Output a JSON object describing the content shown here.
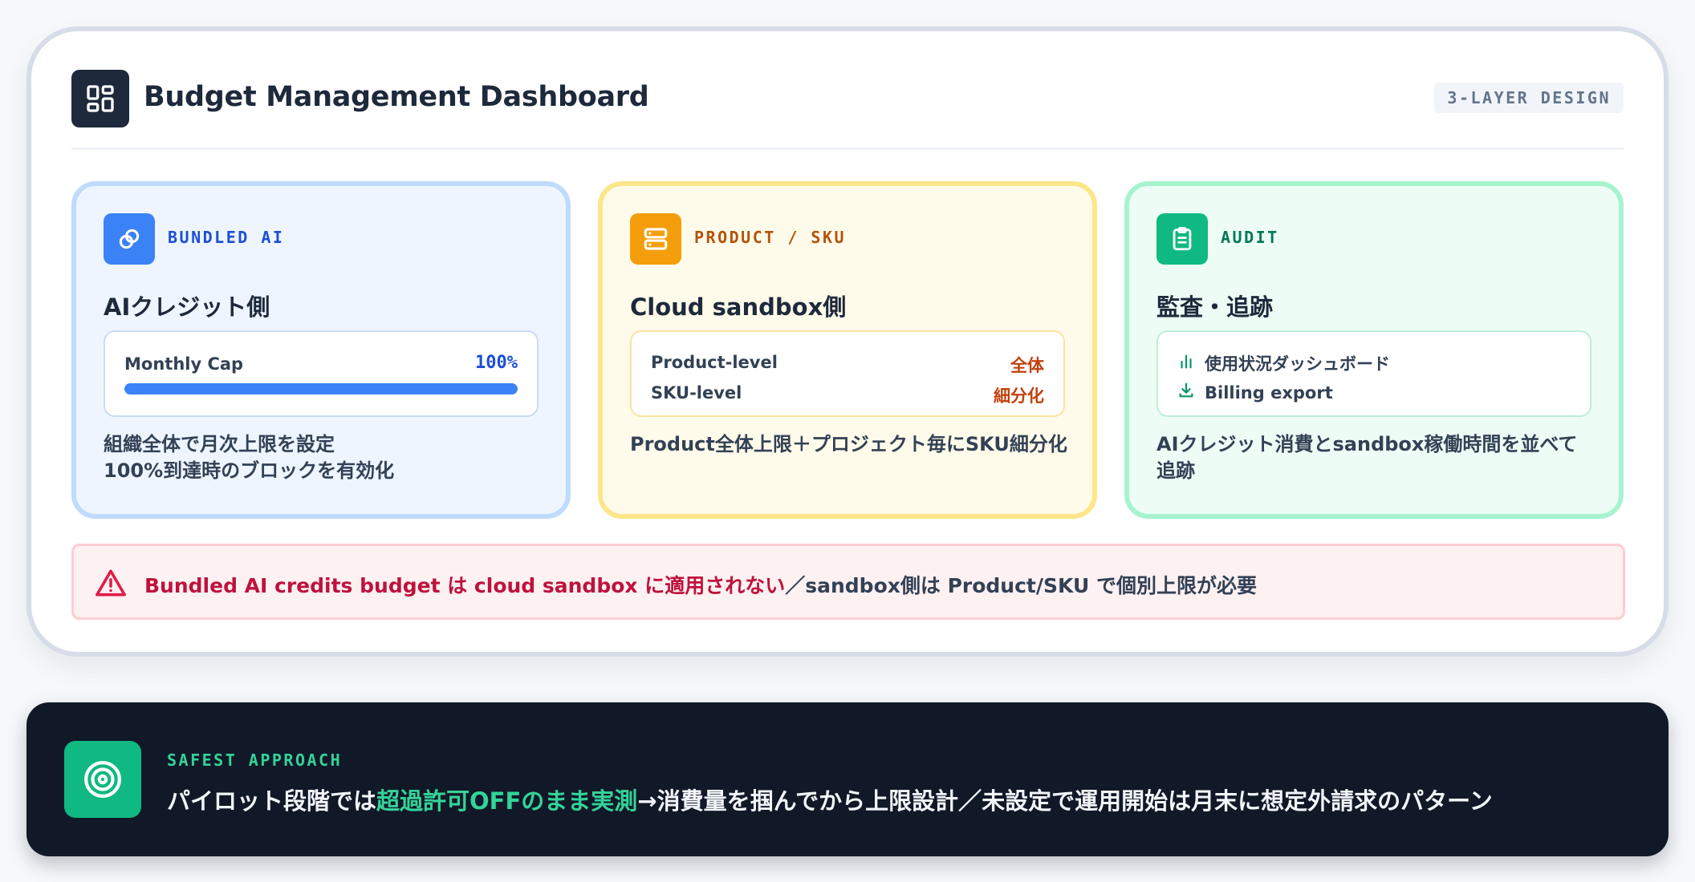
{
  "header": {
    "title": "Budget Management Dashboard",
    "tag": "3-LAYER DESIGN",
    "logo_icon": "dashboard-grid-icon"
  },
  "cards": [
    {
      "tag": "BUNDLED AI",
      "icon": "link-icon",
      "title": "AIクレジット側",
      "cap_label": "Monthly Cap",
      "cap_value": "100%",
      "cap_fraction": 1.0,
      "desc_line1": "組織全体で月次上限を設定",
      "desc_line2": "100%到達時のブロックを有効化",
      "accent": "#3b82f6"
    },
    {
      "tag": "PRODUCT / SKU",
      "icon": "server-icon",
      "title": "Cloud sandbox側",
      "rows": [
        {
          "label": "Product-level",
          "value": "全体"
        },
        {
          "label": "SKU-level",
          "value": "細分化"
        }
      ],
      "desc": "Product全体上限＋プロジェクト毎にSKU細分化",
      "accent": "#f59e0b"
    },
    {
      "tag": "AUDIT",
      "icon": "clipboard-icon",
      "title": "監査・追跡",
      "items": [
        {
          "icon": "bar-chart-icon",
          "label": "使用状況ダッシュボード"
        },
        {
          "icon": "download-icon",
          "label": "Billing export"
        }
      ],
      "desc": "AIクレジット消費とsandbox稼働時間を並べて追跡",
      "accent": "#10b981"
    }
  ],
  "warning": {
    "icon": "warning-triangle-icon",
    "highlight": "Bundled AI credits budget は cloud sandbox に適用されない",
    "rest": "／sandbox側は Product/SKU で個別上限が必要"
  },
  "approach": {
    "icon": "target-icon",
    "tag": "SAFEST APPROACH",
    "text_before": "パイロット段階では",
    "text_highlight": "超過許可OFFのまま実測",
    "text_after": "→消費量を掴んでから上限設計／未設定で運用開始は月末に想定外請求のパターン"
  }
}
